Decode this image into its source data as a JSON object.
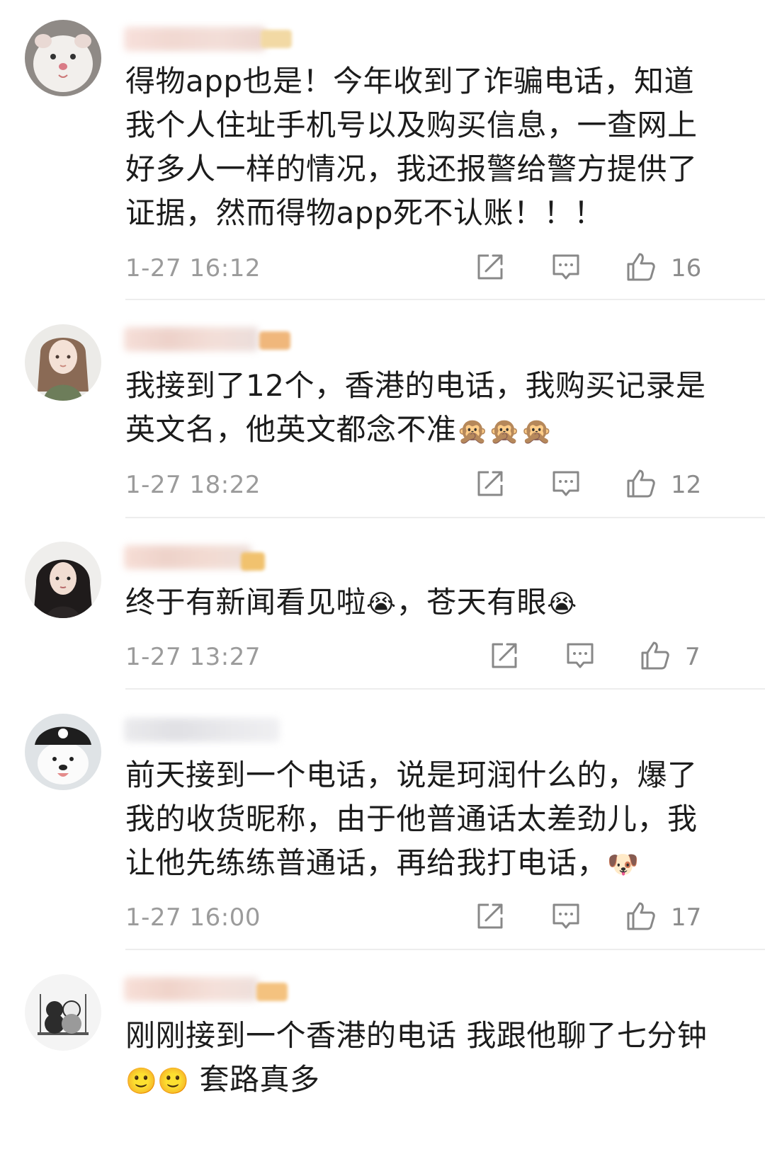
{
  "comments": [
    {
      "text": "得物app也是！今年收到了诈骗电话，知道我个人住址手机号以及购买信息，一查网上好多人一样的情况，我还报警给警方提供了证据，然而得物app死不认账！！！",
      "emoji": "",
      "time": "1-27 16:12",
      "likes": "16",
      "avatar_icon": "hamster-avatar-icon"
    },
    {
      "text": "我接到了12个，香港的电话，我购买记录是英文名，他英文都念不准",
      "emoji": "🙊🙊🙊",
      "time": "1-27 18:22",
      "likes": "12",
      "avatar_icon": "girl-avatar-icon"
    },
    {
      "text_a": "终于有新闻看见啦",
      "emoji_a": "😭",
      "text_b": "，苍天有眼",
      "emoji_b": "😭",
      "time": "1-27 13:27",
      "likes": "7",
      "avatar_icon": "dark-hair-girl-avatar-icon"
    },
    {
      "text": "前天接到一个电话，说是珂润什么的，爆了我的收货昵称，由于他普通话太差劲儿，我让他先练练普通话，再给我打电话，",
      "emoji": "🐶",
      "time": "1-27 16:00",
      "likes": "17",
      "avatar_icon": "pirate-dog-avatar-icon"
    },
    {
      "text": "刚刚接到一个香港的电话 我跟他聊了七分钟",
      "emoji": "🙂🙂",
      "text_b": " 套路真多",
      "avatar_icon": "couple-avatar-icon"
    }
  ]
}
